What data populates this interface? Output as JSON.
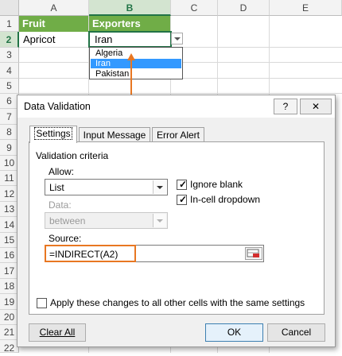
{
  "sheet": {
    "columns": [
      "A",
      "B",
      "C",
      "D",
      "E"
    ],
    "rows": [
      "1",
      "2",
      "3",
      "4",
      "5",
      "6",
      "7",
      "8",
      "9",
      "10",
      "11",
      "12",
      "13",
      "14",
      "15",
      "16",
      "17",
      "18",
      "19",
      "20",
      "21",
      "22"
    ],
    "header_row": {
      "a1": "Fruit",
      "b1": "Exporters"
    },
    "row2": {
      "a2": "Apricot",
      "b2": "Iran"
    },
    "dropdown_items": [
      "Algeria",
      "Iran",
      "Pakistan"
    ],
    "dropdown_selected": "Iran"
  },
  "dialog": {
    "title": "Data Validation",
    "help_button": "?",
    "close_button": "✕",
    "tabs": [
      "Settings",
      "Input Message",
      "Error Alert"
    ],
    "active_tab": "Settings",
    "group_label": "Validation criteria",
    "allow_label": "Allow:",
    "allow_value": "List",
    "data_label": "Data:",
    "data_value": "between",
    "ignore_blank": "Ignore blank",
    "in_cell_dropdown": "In-cell dropdown",
    "source_label": "Source:",
    "source_value": "=INDIRECT(A2)",
    "apply_all": "Apply these changes to all other cells with the same settings",
    "clear_all": "Clear All",
    "ok": "OK",
    "cancel": "Cancel"
  },
  "colors": {
    "header_fill": "#70ad47",
    "selection": "#217346",
    "arrow": "#e87722",
    "dropdown_highlight": "#3399ff"
  }
}
